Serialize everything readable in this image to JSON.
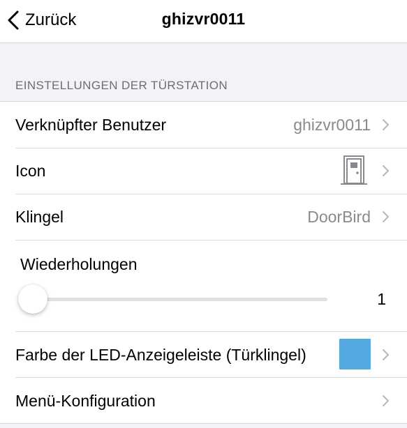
{
  "navbar": {
    "back_label": "Zurück",
    "title": "ghizvr0011"
  },
  "section_header": "EINSTELLUNGEN DER TÜRSTATION",
  "rows": [
    {
      "label": "Verknüpfter Benutzer",
      "value": "ghizvr0011"
    },
    {
      "label": "Icon",
      "icon": "door-icon"
    },
    {
      "label": "Klingel",
      "value": "DoorBird"
    }
  ],
  "repetitions": {
    "label": "Wiederholungen",
    "value": "1",
    "slider_fraction": 0.0
  },
  "led": {
    "label": "Farbe der LED-Anzeigeleiste (Türklingel)",
    "color": "#56a8e0"
  },
  "menu": {
    "label": "Menü-Konfiguration"
  },
  "colors": {
    "accent": "#56a8e0",
    "secondary_text": "#8a8a8e",
    "background": "#f2f2f7"
  }
}
